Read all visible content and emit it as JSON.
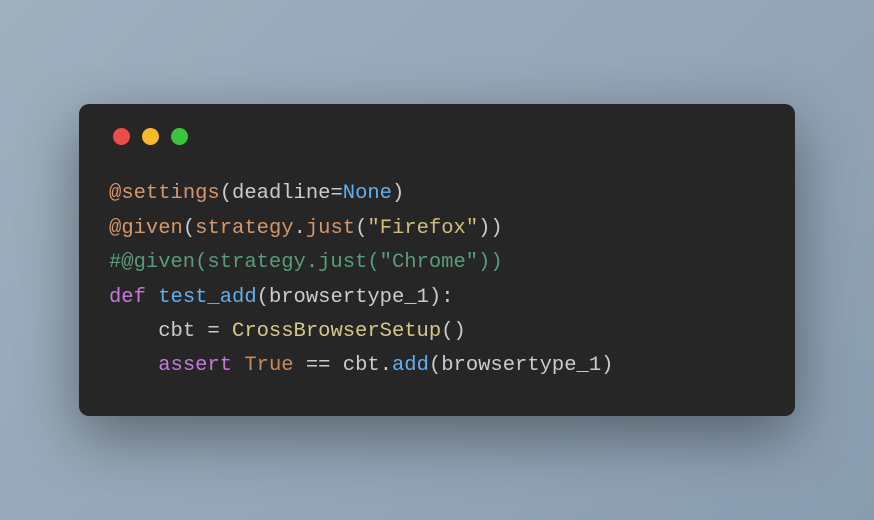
{
  "window": {
    "dots": {
      "close": "red",
      "minimize": "yellow",
      "maximize": "green"
    }
  },
  "code": {
    "line1": {
      "at": "@",
      "decorator": "settings",
      "open": "(",
      "param": "deadline",
      "equals": "=",
      "value": "None",
      "close": ")"
    },
    "line2": {
      "at": "@",
      "decorator": "given",
      "open": "(",
      "obj": "strategy",
      "dot": ".",
      "method": "just",
      "open2": "(",
      "string": "\"Firefox\"",
      "close": "))"
    },
    "line3": {
      "comment": "#@given(strategy.just(\"Chrome\"))"
    },
    "line4": {
      "def": "def",
      "space": " ",
      "funcname": "test_add",
      "open": "(",
      "param": "browsertype_1",
      "close": "):"
    },
    "line5": {
      "indent": "    ",
      "var": "cbt",
      "equals": " = ",
      "classname": "CrossBrowserSetup",
      "parens": "()"
    },
    "line6": {
      "indent": "    ",
      "assert": "assert",
      "space1": " ",
      "true": "True",
      "equals": " == ",
      "var": "cbt",
      "dot": ".",
      "method": "add",
      "open": "(",
      "param": "browsertype_1",
      "close": ")"
    }
  }
}
